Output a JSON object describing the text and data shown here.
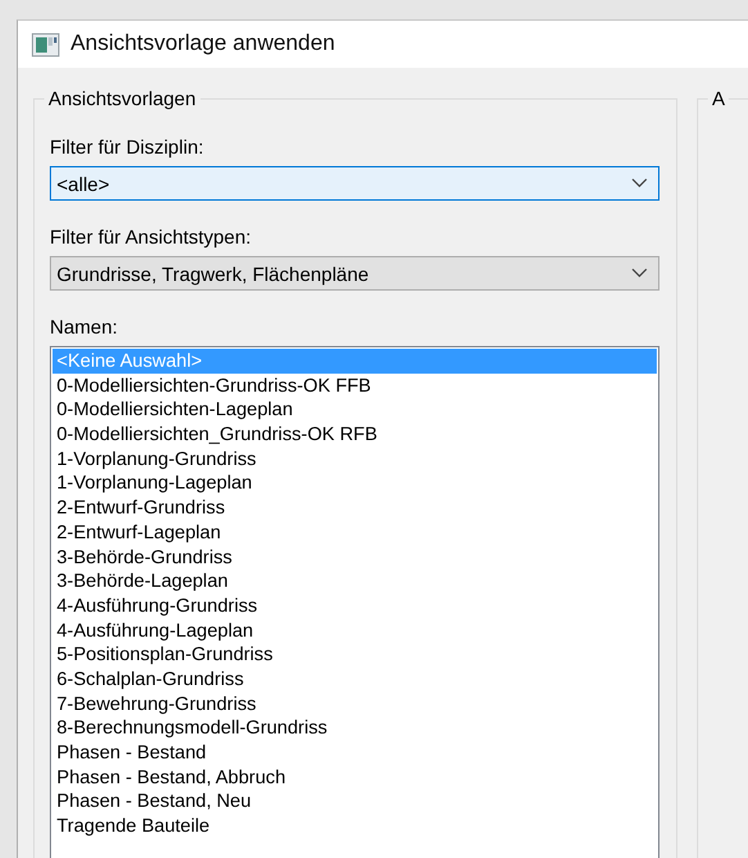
{
  "window": {
    "title": "Ansichtsvorlage anwenden"
  },
  "group": {
    "title": "Ansichtsvorlagen",
    "discipline_filter": {
      "label": "Filter für Disziplin:",
      "value": "<alle>",
      "focused": true
    },
    "view_type_filter": {
      "label": "Filter für Ansichtstypen:",
      "value": "Grundrisse, Tragwerk, Flächenpläne",
      "focused": false
    },
    "names": {
      "label": "Namen:",
      "items": [
        {
          "text": "<Keine Auswahl>",
          "selected": true
        },
        {
          "text": "0-Modelliersichten-Grundriss-OK FFB",
          "selected": false
        },
        {
          "text": "0-Modelliersichten-Lageplan",
          "selected": false
        },
        {
          "text": "0-Modelliersichten_Grundriss-OK RFB",
          "selected": false
        },
        {
          "text": "1-Vorplanung-Grundriss",
          "selected": false
        },
        {
          "text": "1-Vorplanung-Lageplan",
          "selected": false
        },
        {
          "text": "2-Entwurf-Grundriss",
          "selected": false
        },
        {
          "text": "2-Entwurf-Lageplan",
          "selected": false
        },
        {
          "text": "3-Behörde-Grundriss",
          "selected": false
        },
        {
          "text": "3-Behörde-Lageplan",
          "selected": false
        },
        {
          "text": "4-Ausführung-Grundriss",
          "selected": false
        },
        {
          "text": "4-Ausführung-Lageplan",
          "selected": false
        },
        {
          "text": "5-Positionsplan-Grundriss",
          "selected": false
        },
        {
          "text": "6-Schalplan-Grundriss",
          "selected": false
        },
        {
          "text": "7-Bewehrung-Grundriss",
          "selected": false
        },
        {
          "text": "8-Berechnungsmodell-Grundriss",
          "selected": false
        },
        {
          "text": "Phasen - Bestand",
          "selected": false
        },
        {
          "text": "Phasen - Bestand, Abbruch",
          "selected": false
        },
        {
          "text": "Phasen - Bestand, Neu",
          "selected": false
        },
        {
          "text": "Tragende Bauteile",
          "selected": false
        }
      ]
    }
  },
  "right_group": {
    "title": "A"
  }
}
